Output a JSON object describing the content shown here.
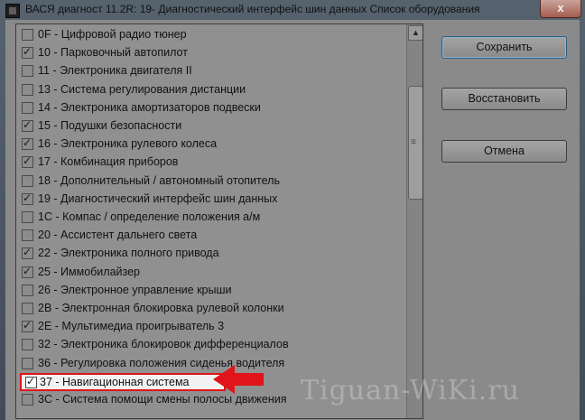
{
  "window": {
    "title": "ВАСЯ диагност 11.2R: 19- Диагностический интерфейс шин данных  Список оборудования",
    "close_label": "x"
  },
  "list": {
    "items": [
      {
        "code": "0F",
        "label": "Цифровой радио тюнер",
        "checked": false
      },
      {
        "code": "10",
        "label": "Парковочный автопилот",
        "checked": true
      },
      {
        "code": "11",
        "label": "Электроника двигателя II",
        "checked": false
      },
      {
        "code": "13",
        "label": "Система регулирования дистанции",
        "checked": false
      },
      {
        "code": "14",
        "label": "Электроника амортизаторов подвески",
        "checked": false
      },
      {
        "code": "15",
        "label": "Подушки безопасности",
        "checked": true
      },
      {
        "code": "16",
        "label": "Электроника рулевого колеса",
        "checked": true
      },
      {
        "code": "17",
        "label": "Комбинация приборов",
        "checked": true
      },
      {
        "code": "18",
        "label": "Дополнительный / автономный отопитель",
        "checked": false
      },
      {
        "code": "19",
        "label": "Диагностический интерфейс шин данных",
        "checked": true
      },
      {
        "code": "1C",
        "label": "Компас / определение положения а/м",
        "checked": false
      },
      {
        "code": "20",
        "label": "Ассистент дальнего света",
        "checked": false
      },
      {
        "code": "22",
        "label": "Электроника полного привода",
        "checked": true
      },
      {
        "code": "25",
        "label": "Иммобилайзер",
        "checked": true
      },
      {
        "code": "26",
        "label": "Электронное управление крыши",
        "checked": false
      },
      {
        "code": "2B",
        "label": "Электронная блокировка рулевой колонки",
        "checked": false
      },
      {
        "code": "2E",
        "label": "Мультимедиа проигрыватель 3",
        "checked": true
      },
      {
        "code": "32",
        "label": "Электроника блокировок дифференциалов",
        "checked": false
      },
      {
        "code": "36",
        "label": "Регулировка положения сиденья водителя",
        "checked": false
      },
      {
        "code": "37",
        "label": "Навигационная система",
        "checked": true,
        "highlighted": true
      },
      {
        "code": "3C",
        "label": "Система помощи смены полосы движения",
        "checked": false
      }
    ]
  },
  "buttons": {
    "save": "Сохранить",
    "restore": "Восстановить",
    "cancel": "Отмена"
  },
  "watermark": "Tiguan-WiKi.ru",
  "colors": {
    "highlight_border": "#e0141a",
    "arrow": "#e0141a"
  }
}
